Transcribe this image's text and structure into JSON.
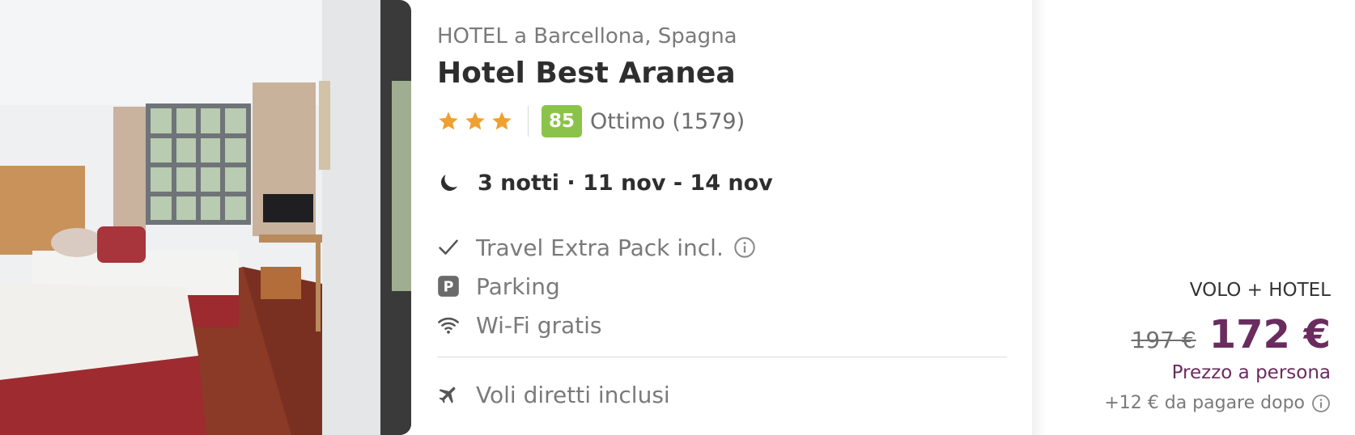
{
  "hotel": {
    "location": "HOTEL a Barcellona, Spagna",
    "name": "Hotel Best Aranea",
    "stars": 3,
    "score": "85",
    "rating_text": "Ottimo (1579)"
  },
  "stay": {
    "summary": "3 notti · 11 nov - 14 nov"
  },
  "features": [
    {
      "icon": "check-icon",
      "label": "Travel Extra Pack incl."
    },
    {
      "icon": "parking-icon",
      "label": "Parking"
    },
    {
      "icon": "wifi-icon",
      "label": "Wi-Fi gratis"
    },
    {
      "icon": "plane-icon",
      "label": "Voli diretti inclusi"
    }
  ],
  "price": {
    "package_type": "VOLO + HOTEL",
    "old_price": "197 €",
    "new_price": "172 €",
    "per_person": "Prezzo a persona",
    "extra_fee": "+12 € da pagare dopo"
  },
  "colors": {
    "accent": "#6a2c5e",
    "star": "#f0a030",
    "score_badge": "#8bc34a"
  }
}
